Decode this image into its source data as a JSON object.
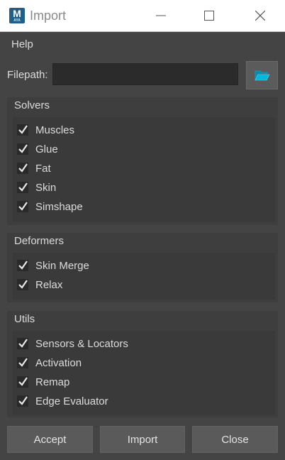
{
  "window": {
    "title": "Import",
    "app_icon": {
      "letter": "M",
      "sub": "AYA",
      "color": "#1f5f8a"
    }
  },
  "menu": {
    "items": [
      "Help"
    ]
  },
  "filepath": {
    "label": "Filepath:",
    "value": ""
  },
  "icons": {
    "browse": "folder-open-icon"
  },
  "groups": {
    "solvers": {
      "title": "Solvers",
      "items": [
        {
          "label": "Muscles",
          "checked": true
        },
        {
          "label": "Glue",
          "checked": true
        },
        {
          "label": "Fat",
          "checked": true
        },
        {
          "label": "Skin",
          "checked": true
        },
        {
          "label": "Simshape",
          "checked": true
        }
      ]
    },
    "deformers": {
      "title": "Deformers",
      "items": [
        {
          "label": "Skin Merge",
          "checked": true
        },
        {
          "label": "Relax",
          "checked": true
        }
      ]
    },
    "utils": {
      "title": "Utils",
      "items": [
        {
          "label": "Sensors & Locators",
          "checked": true
        },
        {
          "label": "Activation",
          "checked": true
        },
        {
          "label": "Remap",
          "checked": true
        },
        {
          "label": "Edge Evaluator",
          "checked": true
        }
      ]
    }
  },
  "buttons": {
    "accept": "Accept",
    "import": "Import",
    "close": "Close"
  },
  "colors": {
    "background": "#444444",
    "group": "#3e3e3e",
    "accent": "#00a3c6"
  }
}
